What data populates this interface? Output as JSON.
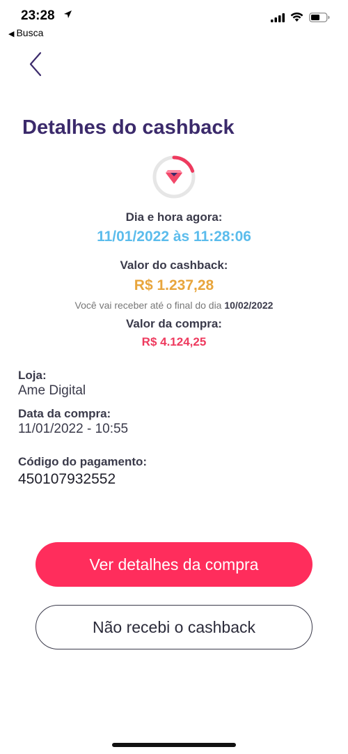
{
  "status_bar": {
    "time": "23:28",
    "back_app": "Busca",
    "icons": [
      "location-arrow-icon",
      "cellular-signal-icon",
      "wifi-icon",
      "battery-icon"
    ]
  },
  "header": {
    "back_icon": "chevron-left-icon",
    "title": "Detalhes do cashback"
  },
  "summary": {
    "status_icon": "diamond-ring-icon",
    "now_label": "Dia e hora agora:",
    "now_value": "11/01/2022 às 11:28:06",
    "cashback_label": "Valor do cashback:",
    "cashback_value": "R$ 1.237,28",
    "receive_note": "Você vai receber até o final do dia",
    "receive_date": "10/02/2022",
    "purchase_label": "Valor da compra:",
    "purchase_value": "R$ 4.124,25"
  },
  "details": {
    "store_label": "Loja:",
    "store_value": "Ame Digital",
    "date_label": "Data da compra:",
    "date_value": "11/01/2022 - 10:55",
    "code_label": "Código do pagamento:",
    "code_value": "450107932552"
  },
  "actions": {
    "primary_label": "Ver detalhes da compra",
    "secondary_label": "Não recebi o cashback"
  },
  "colors": {
    "title": "#3b2a6b",
    "accent_blue": "#5bbcec",
    "accent_orange": "#e8a53c",
    "accent_red": "#ee3a5e",
    "primary_button": "#ff2d5c"
  }
}
